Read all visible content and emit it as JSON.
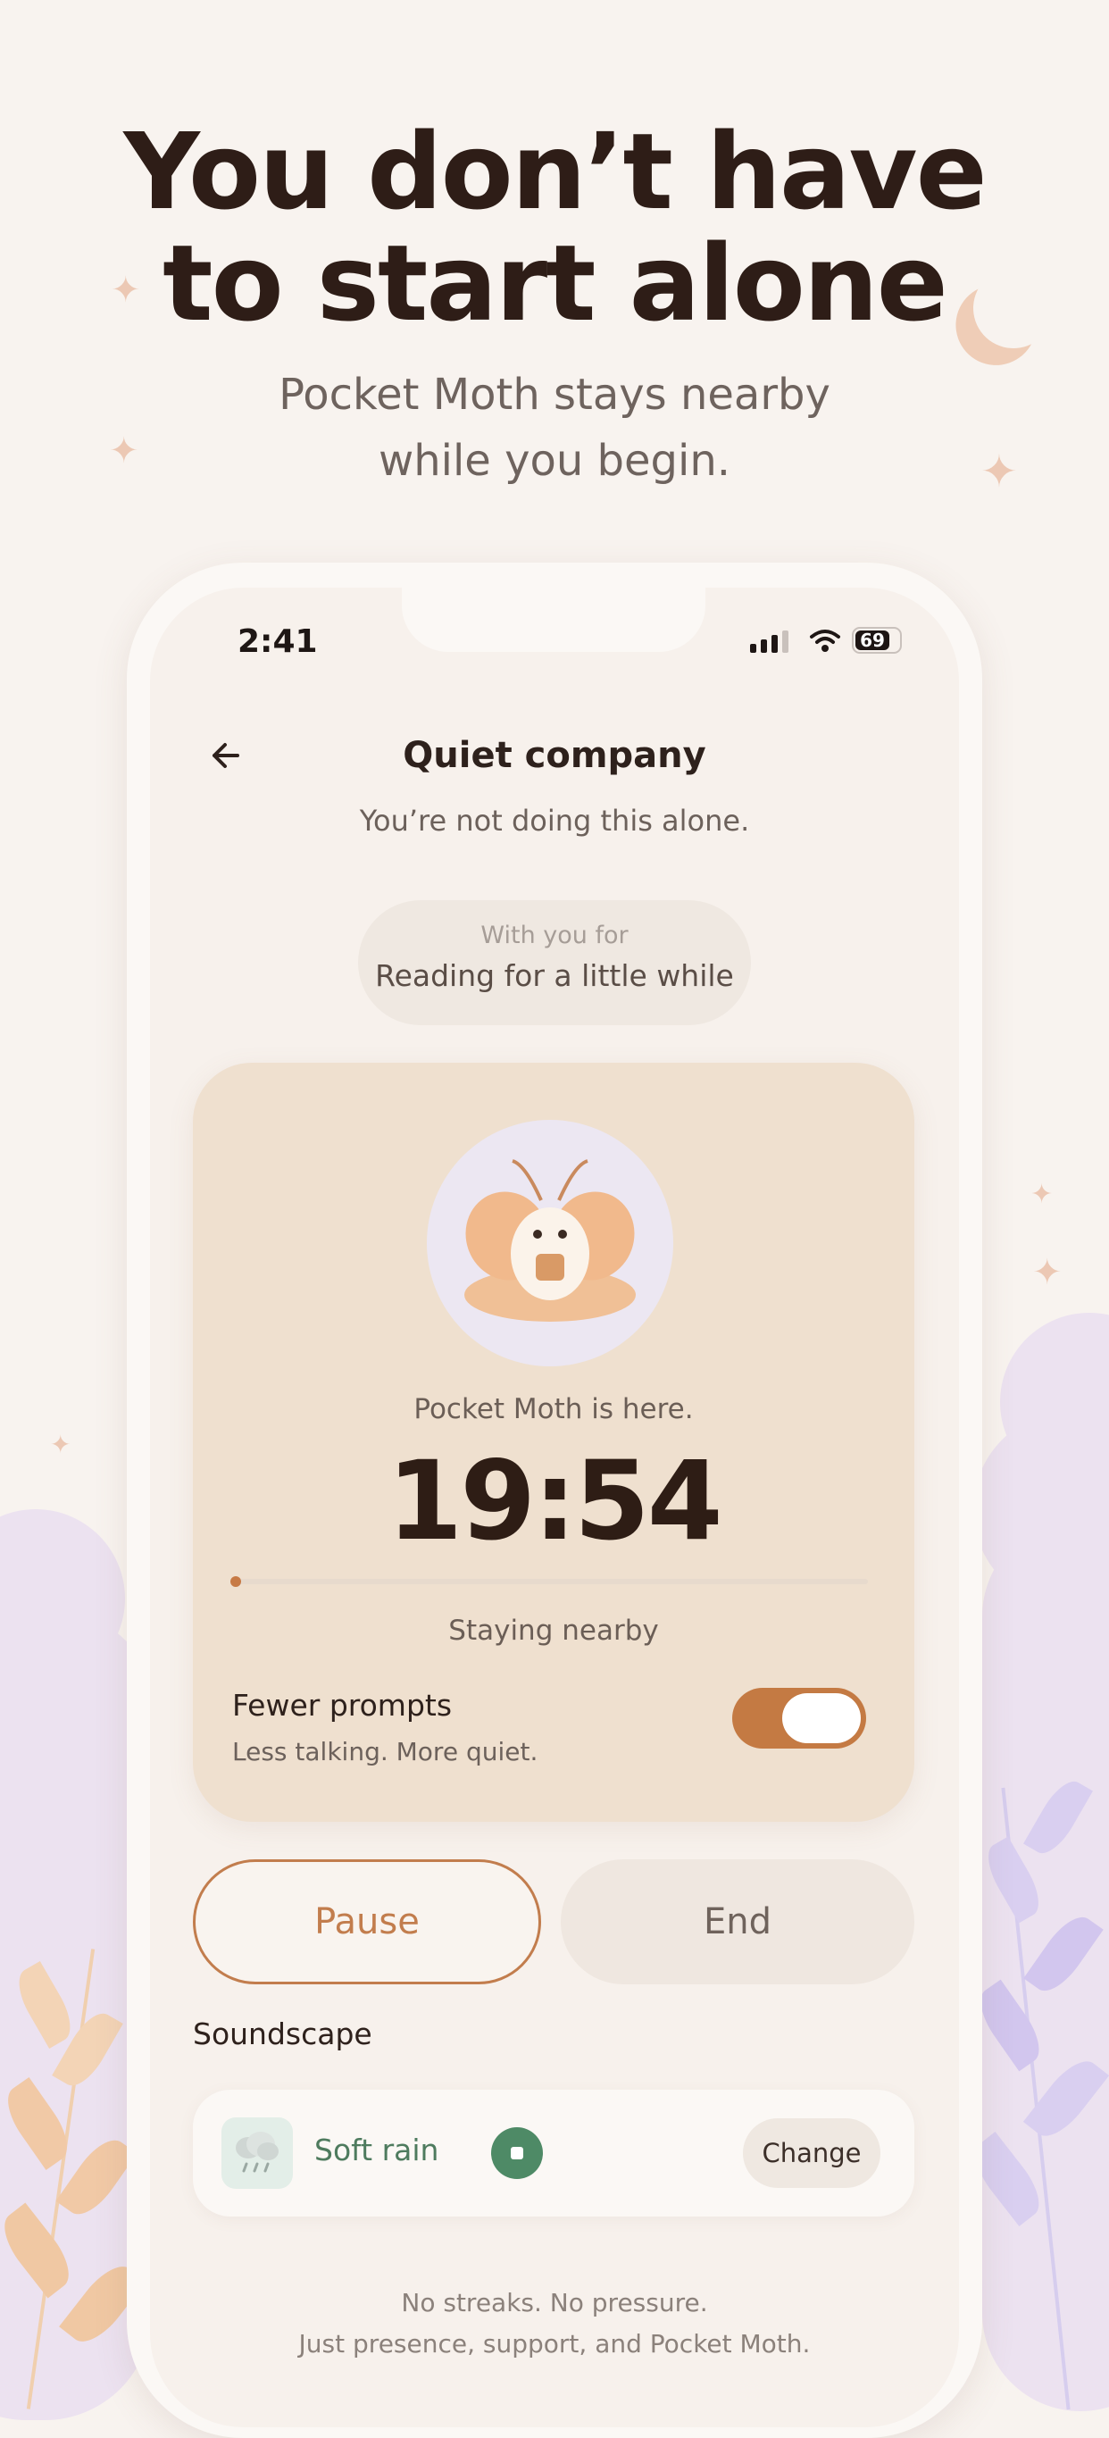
{
  "hero": {
    "title_line1": "You don’t have",
    "title_line2": "to start alone",
    "subtitle_line1": "Pocket Moth stays nearby",
    "subtitle_line2": "while you begin."
  },
  "status_bar": {
    "time": "2:41",
    "battery": "69"
  },
  "nav": {
    "title": "Quiet company",
    "subtitle": "You’re not doing this alone."
  },
  "with_you": {
    "label": "With you for",
    "task": "Reading for a little while"
  },
  "session": {
    "companion_status": "Pocket Moth is here.",
    "timer": "19:54",
    "progress": 0.01,
    "progress_caption": "Staying nearby",
    "fewer_prompts_title": "Fewer prompts",
    "fewer_prompts_subtitle": "Less talking. More quiet.",
    "fewer_prompts_on": true
  },
  "actions": {
    "pause_label": "Pause",
    "end_label": "End"
  },
  "soundscape": {
    "section_label": "Soundscape",
    "icon": "rain-cloud-icon",
    "name": "Soft rain",
    "change_label": "Change"
  },
  "footer": {
    "line1": "No streaks. No pressure.",
    "line2": "Just presence, support, and Pocket Moth."
  },
  "colors": {
    "accent": "#c47a43",
    "sound_green": "#4e8a66",
    "card": "#efe0cf",
    "background": "#f8f3ef"
  }
}
